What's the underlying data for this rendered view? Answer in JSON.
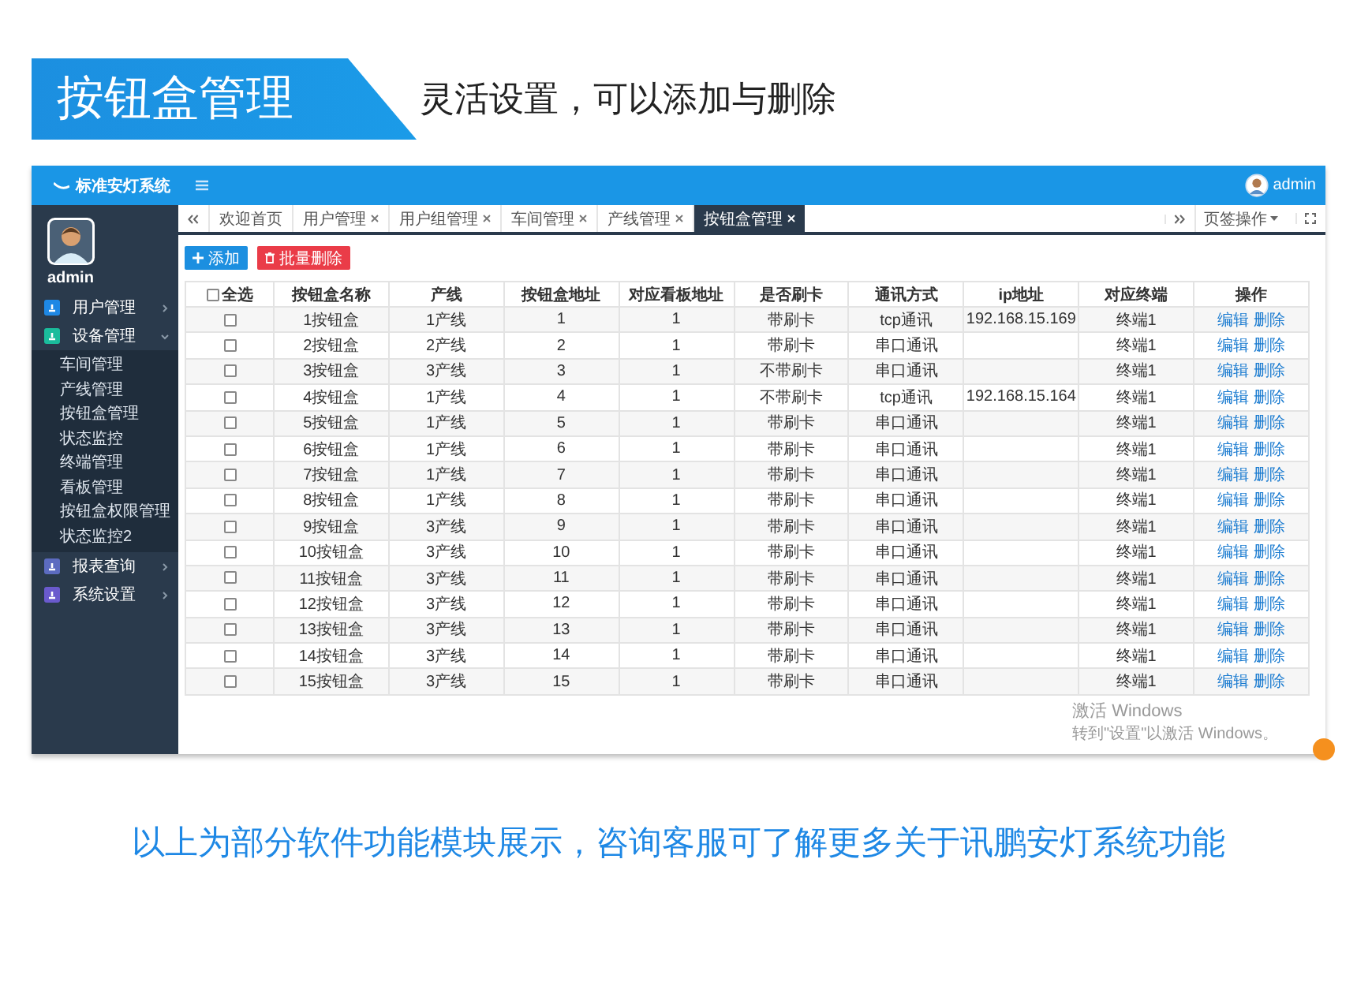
{
  "banner": {
    "title": "按钮盒管理",
    "subtitle": "灵活设置，可以添加与删除"
  },
  "app": {
    "brand": "标准安灯系统",
    "user": "admin",
    "sidebar": {
      "user": "admin",
      "items": [
        {
          "label": "用户管理",
          "color": "#1e88e5",
          "expanded": false
        },
        {
          "label": "设备管理",
          "color": "#1abc9c",
          "expanded": true,
          "children": [
            {
              "label": "车间管理"
            },
            {
              "label": "产线管理"
            },
            {
              "label": "按钮盒管理"
            },
            {
              "label": "状态监控"
            },
            {
              "label": "终端管理"
            },
            {
              "label": "看板管理"
            },
            {
              "label": "按钮盒权限管理"
            },
            {
              "label": "状态监控2"
            }
          ]
        },
        {
          "label": "报表查询",
          "color": "#5c6bc0",
          "expanded": false
        },
        {
          "label": "系统设置",
          "color": "#6a5acd",
          "expanded": false
        }
      ]
    },
    "tabs": [
      {
        "label": "欢迎首页",
        "closable": false,
        "selected": false
      },
      {
        "label": "用户管理",
        "closable": true,
        "selected": false
      },
      {
        "label": "用户组管理",
        "closable": true,
        "selected": false
      },
      {
        "label": "车间管理",
        "closable": true,
        "selected": false
      },
      {
        "label": "产线管理",
        "closable": true,
        "selected": false
      },
      {
        "label": "按钮盒管理",
        "closable": true,
        "selected": true
      }
    ],
    "tab_menu": "页签操作",
    "toolbar": [
      {
        "label": "添加",
        "kind": "add"
      },
      {
        "label": "批量删除",
        "kind": "delete"
      }
    ],
    "table": {
      "select_all": {
        "label": "全选",
        "checked": false
      },
      "columns": [
        "按钮盒名称",
        "产线",
        "按钮盒地址",
        "对应看板地址",
        "是否刷卡",
        "通讯方式",
        "ip地址",
        "对应终端",
        "操作"
      ],
      "rows": [
        {
          "checked": false,
          "cells": [
            "1按钮盒",
            "1产线",
            "1",
            "1",
            "带刷卡",
            "tcp通讯",
            "192.168.15.169",
            "终端1"
          ],
          "actions": [
            "编辑",
            "删除"
          ]
        },
        {
          "checked": false,
          "cells": [
            "2按钮盒",
            "2产线",
            "2",
            "1",
            "带刷卡",
            "串口通讯",
            "",
            "终端1"
          ],
          "actions": [
            "编辑",
            "删除"
          ]
        },
        {
          "checked": false,
          "cells": [
            "3按钮盒",
            "3产线",
            "3",
            "1",
            "不带刷卡",
            "串口通讯",
            "",
            "终端1"
          ],
          "actions": [
            "编辑",
            "删除"
          ]
        },
        {
          "checked": false,
          "cells": [
            "4按钮盒",
            "1产线",
            "4",
            "1",
            "不带刷卡",
            "tcp通讯",
            "192.168.15.164",
            "终端1"
          ],
          "actions": [
            "编辑",
            "删除"
          ]
        },
        {
          "checked": false,
          "cells": [
            "5按钮盒",
            "1产线",
            "5",
            "1",
            "带刷卡",
            "串口通讯",
            "",
            "终端1"
          ],
          "actions": [
            "编辑",
            "删除"
          ]
        },
        {
          "checked": false,
          "cells": [
            "6按钮盒",
            "1产线",
            "6",
            "1",
            "带刷卡",
            "串口通讯",
            "",
            "终端1"
          ],
          "actions": [
            "编辑",
            "删除"
          ]
        },
        {
          "checked": false,
          "cells": [
            "7按钮盒",
            "1产线",
            "7",
            "1",
            "带刷卡",
            "串口通讯",
            "",
            "终端1"
          ],
          "actions": [
            "编辑",
            "删除"
          ]
        },
        {
          "checked": false,
          "cells": [
            "8按钮盒",
            "1产线",
            "8",
            "1",
            "带刷卡",
            "串口通讯",
            "",
            "终端1"
          ],
          "actions": [
            "编辑",
            "删除"
          ]
        },
        {
          "checked": false,
          "cells": [
            "9按钮盒",
            "3产线",
            "9",
            "1",
            "带刷卡",
            "串口通讯",
            "",
            "终端1"
          ],
          "actions": [
            "编辑",
            "删除"
          ]
        },
        {
          "checked": false,
          "cells": [
            "10按钮盒",
            "3产线",
            "10",
            "1",
            "带刷卡",
            "串口通讯",
            "",
            "终端1"
          ],
          "actions": [
            "编辑",
            "删除"
          ]
        },
        {
          "checked": false,
          "cells": [
            "11按钮盒",
            "3产线",
            "11",
            "1",
            "带刷卡",
            "串口通讯",
            "",
            "终端1"
          ],
          "actions": [
            "编辑",
            "删除"
          ]
        },
        {
          "checked": false,
          "cells": [
            "12按钮盒",
            "3产线",
            "12",
            "1",
            "带刷卡",
            "串口通讯",
            "",
            "终端1"
          ],
          "actions": [
            "编辑",
            "删除"
          ]
        },
        {
          "checked": false,
          "cells": [
            "13按钮盒",
            "3产线",
            "13",
            "1",
            "带刷卡",
            "串口通讯",
            "",
            "终端1"
          ],
          "actions": [
            "编辑",
            "删除"
          ]
        },
        {
          "checked": false,
          "cells": [
            "14按钮盒",
            "3产线",
            "14",
            "1",
            "带刷卡",
            "串口通讯",
            "",
            "终端1"
          ],
          "actions": [
            "编辑",
            "删除"
          ]
        },
        {
          "checked": false,
          "cells": [
            "15按钮盒",
            "3产线",
            "15",
            "1",
            "带刷卡",
            "串口通讯",
            "",
            "终端1"
          ],
          "actions": [
            "编辑",
            "删除"
          ]
        }
      ]
    },
    "activation_notice": {
      "title": "激活 Windows",
      "hint": "转到\"设置\"以激活 Windows。"
    }
  },
  "footer": "以上为部分软件功能模块展示，咨询客服可了解更多关于讯鹏安灯系统功能"
}
